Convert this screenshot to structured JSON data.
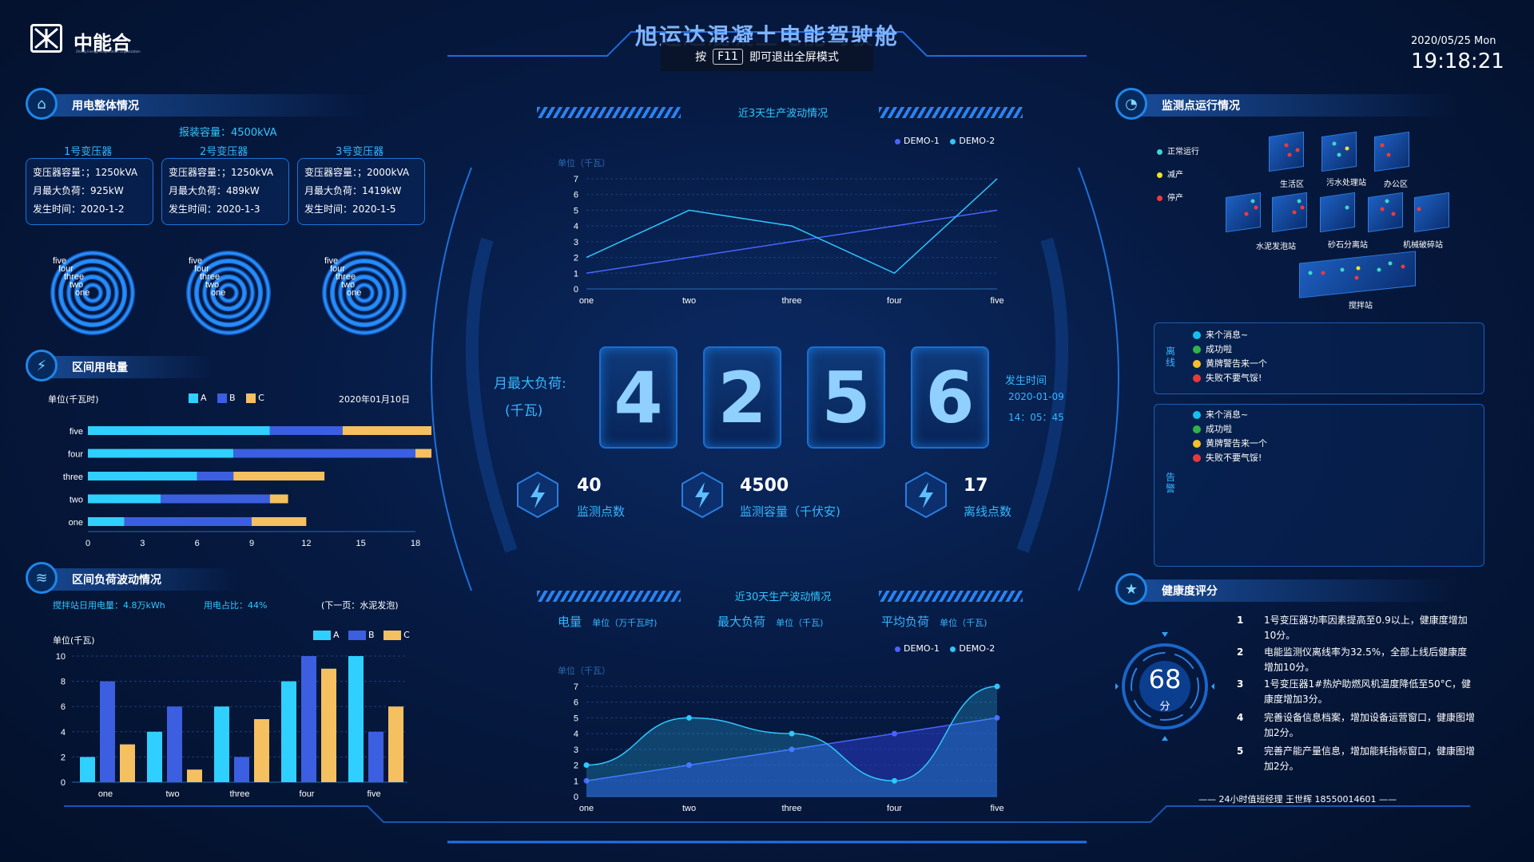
{
  "header": {
    "logo_text": "中能合",
    "logo_sub": "Zhong Energy Cooperation Organization",
    "title": "旭运达混凝土电能驾驶舱",
    "fullscreen_prefix": "按",
    "fullscreen_key": "F11",
    "fullscreen_suffix": "即可退出全屏模式",
    "date": "2020/05/25 Mon",
    "time": "19:18:21"
  },
  "power_overview": {
    "title": "用电整体情况",
    "capacity": "报装容量：4500kVA",
    "transformers": [
      {
        "name": "1号变压器",
        "cap": "变压器容量：；1250kVA",
        "load": "月最大负荷：925kW",
        "time": "发生时间：2020-1-2"
      },
      {
        "name": "2号变压器",
        "cap": "变压器容量：；1250kVA",
        "load": "月最大负荷：489kW",
        "time": "发生时间：2020-1-3"
      },
      {
        "name": "3号变压器",
        "cap": "变压器容量：；2000kVA",
        "load": "月最大负荷：1419kW",
        "time": "发生时间：2020-1-5"
      }
    ],
    "ring_labels": [
      "five",
      "four",
      "three",
      "two",
      "one"
    ]
  },
  "interval_power": {
    "title": "区间用电量",
    "unit": "单位(千瓦时)",
    "legend": [
      "A",
      "B",
      "C"
    ],
    "date": "2020年01月10日"
  },
  "load_wave": {
    "title": "区间负荷波动情况",
    "info1": "搅拌站日用电量：4.8万kWh",
    "info2": "用电占比：44%",
    "next": "(下一页：水泥发泡)",
    "unit": "单位(千瓦)",
    "legend": [
      "A",
      "B",
      "C"
    ]
  },
  "center": {
    "top_title": "近3天生产波动情况",
    "bottom_title": "近30天生产波动情况",
    "unit_label": "单位（千瓦）",
    "legend": [
      "DEMO-1",
      "DEMO-2"
    ],
    "max_load_label": "月最大负荷:",
    "max_load_unit": "(千瓦)",
    "digits": [
      "4",
      "2",
      "5",
      "6"
    ],
    "occur_label": "发生时间",
    "occur_date": "2020-01-09",
    "occur_time": "14：05：45",
    "stats": [
      {
        "num": "40",
        "label": "监测点数"
      },
      {
        "num": "4500",
        "label": "监测容量（千伏安)"
      },
      {
        "num": "17",
        "label": "离线点数"
      }
    ],
    "tabs": [
      {
        "name": "电量",
        "unit": "单位（万千瓦时)"
      },
      {
        "name": "最大负荷",
        "unit": "单位（千瓦)"
      },
      {
        "name": "平均负荷",
        "unit": "单位（千瓦)"
      }
    ]
  },
  "monitor": {
    "title": "监测点运行情况",
    "legend": [
      "正常运行",
      "减产",
      "停产"
    ],
    "sites": [
      "生活区",
      "污水处理站",
      "办公区",
      "水泥发泡站",
      "砂石分离站",
      "机械破碎站",
      "搅拌站"
    ],
    "offline_label": "离线",
    "alarm_label": "告警",
    "messages": [
      "来个消息~",
      "成功啦",
      "黄牌警告来一个",
      "失败不要气馁!"
    ],
    "msg_colors": [
      "#12c2e9",
      "#2fb34a",
      "#f5c12a",
      "#e63a3a"
    ]
  },
  "health": {
    "title": "健康度评分",
    "score": "68",
    "score_unit": "分",
    "items": [
      {
        "n": "1",
        "text": "1号变压器功率因素提高至0.9以上，健康度增加10分。"
      },
      {
        "n": "2",
        "text": "电能监测仪离线率为32.5%，全部上线后健康度增加10分。"
      },
      {
        "n": "3",
        "text": "1号变压器1#热炉助燃风机温度降低至50°C，健康度增加3分。"
      },
      {
        "n": "4",
        "text": "完善设备信息档案，增加设备运营窗口，健康图增加2分。"
      },
      {
        "n": "5",
        "text": "完善产能产量信息，增加能耗指标窗口，健康图增加2分。"
      }
    ],
    "footer": "—— 24小时值班经理  王世辉  18550014601 ——"
  },
  "chart_data": [
    {
      "type": "bar",
      "orientation": "horizontal",
      "stacked": true,
      "title": "区间用电量",
      "categories": [
        "one",
        "two",
        "three",
        "four",
        "five"
      ],
      "series": [
        {
          "name": "A",
          "values": [
            2,
            4,
            6,
            8,
            10
          ]
        },
        {
          "name": "B",
          "values": [
            7,
            6,
            2,
            10,
            4
          ]
        },
        {
          "name": "C",
          "values": [
            3,
            1,
            5,
            2,
            6
          ]
        }
      ],
      "xlim": [
        0,
        18
      ],
      "xticks": [
        0,
        3,
        6,
        9,
        12,
        15,
        18
      ],
      "colors": [
        "#2fd0ff",
        "#3b5fe0",
        "#f5c060"
      ]
    },
    {
      "type": "bar",
      "title": "区间负荷波动情况",
      "ylabel": "单位(千瓦)",
      "categories": [
        "one",
        "two",
        "three",
        "four",
        "five"
      ],
      "series": [
        {
          "name": "A",
          "values": [
            2,
            4,
            6,
            8,
            10
          ]
        },
        {
          "name": "B",
          "values": [
            8,
            6,
            2,
            10,
            4
          ]
        },
        {
          "name": "C",
          "values": [
            3,
            1,
            5,
            9,
            6
          ]
        }
      ],
      "ylim": [
        0,
        10
      ],
      "yticks": [
        0,
        2,
        4,
        6,
        8,
        10
      ],
      "colors": [
        "#2fd0ff",
        "#3b5fe0",
        "#f5c060"
      ]
    },
    {
      "type": "line",
      "title": "近3天生产波动情况",
      "ylabel": "单位（千瓦）",
      "categories": [
        "one",
        "two",
        "three",
        "four",
        "five"
      ],
      "series": [
        {
          "name": "DEMO-1",
          "values": [
            1,
            2,
            3,
            4,
            5
          ]
        },
        {
          "name": "DEMO-2",
          "values": [
            2,
            5,
            4,
            1,
            7
          ]
        }
      ],
      "ylim": [
        0,
        7
      ],
      "colors": [
        "#4a63ff",
        "#2fc7ff"
      ]
    },
    {
      "type": "area",
      "title": "近30天生产波动情况",
      "ylabel": "单位（千瓦）",
      "categories": [
        "one",
        "two",
        "three",
        "four",
        "five"
      ],
      "series": [
        {
          "name": "DEMO-1",
          "values": [
            1,
            2,
            3,
            4,
            5
          ]
        },
        {
          "name": "DEMO-2",
          "values": [
            2,
            5,
            4,
            1,
            7
          ]
        }
      ],
      "ylim": [
        0,
        7
      ],
      "colors": [
        "#4a63ff",
        "#2fc7ff"
      ]
    }
  ]
}
